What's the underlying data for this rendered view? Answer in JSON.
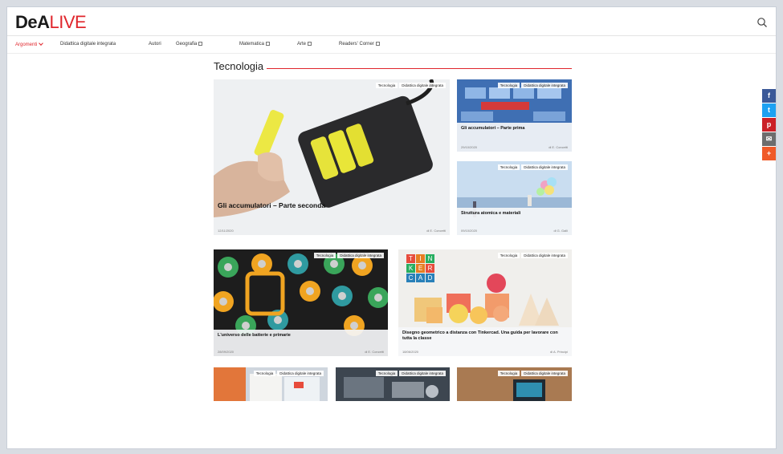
{
  "brand": {
    "dea": "DeA",
    "live": "LIVE",
    "accent": "#e0262c"
  },
  "nav": {
    "items": [
      {
        "label": "Argomenti",
        "kind": "dropdown"
      },
      {
        "label": "Didattica digitale integrata"
      },
      {
        "label": "Autori"
      },
      {
        "label": "Geografia",
        "kind": "external"
      },
      {
        "label": "Matematica",
        "kind": "external"
      },
      {
        "label": "Arte",
        "kind": "external"
      },
      {
        "label": "Readers' Corner",
        "kind": "external"
      }
    ]
  },
  "section": {
    "title": "Tecnologia"
  },
  "articles": [
    {
      "title": "Gli accumulatori – Parte seconda",
      "date": "12/11/2020",
      "author": "di E. Concetti",
      "badges": [
        "Tecnologia",
        "Didattica digitale integrata"
      ]
    },
    {
      "title": "Gli accumulatori – Parte prima",
      "date": "29/10/2020",
      "author": "di E. Concetti",
      "badges": [
        "Tecnologia",
        "Didattica digitale integrata"
      ]
    },
    {
      "title": "Struttura atomica e materiali",
      "date": "09/10/2020",
      "author": "di G. Galli",
      "badges": [
        "Tecnologia",
        "Didattica digitale integrata"
      ]
    },
    {
      "title": "L'universo delle batterie e primarie",
      "date": "28/09/2020",
      "author": "di E. Concetti",
      "badges": [
        "Tecnologia",
        "Didattica digitale integrata"
      ]
    },
    {
      "title": "Disegno geometrico a distanza con Tinkercad. Una guida per lavorare con tutta la classe",
      "date": "18/06/2020",
      "author": "di A. Principi",
      "badges": [
        "Tecnologia",
        "Didattica digitale integrata"
      ]
    },
    {
      "title": "",
      "date": "",
      "author": "",
      "badges": [
        "Tecnologia",
        "Didattica digitale integrata"
      ]
    },
    {
      "title": "",
      "date": "",
      "author": "",
      "badges": [
        "Tecnologia",
        "Didattica digitale integrata"
      ]
    },
    {
      "title": "",
      "date": "",
      "author": "",
      "badges": [
        "Tecnologia",
        "Didattica digitale integrata"
      ]
    }
  ],
  "tinkercad_letters": [
    "T",
    "I",
    "N",
    "K",
    "E",
    "R",
    "C",
    "A",
    "D"
  ],
  "share": [
    {
      "icon": "facebook-icon",
      "glyph": "f",
      "color": "#3b5998"
    },
    {
      "icon": "twitter-icon",
      "glyph": "t",
      "color": "#1da1f2"
    },
    {
      "icon": "pinterest-icon",
      "glyph": "p",
      "color": "#cb2027"
    },
    {
      "icon": "email-icon",
      "glyph": "✉",
      "color": "#6d6d6d"
    },
    {
      "icon": "plus-icon",
      "glyph": "+",
      "color": "#f05a28"
    }
  ]
}
